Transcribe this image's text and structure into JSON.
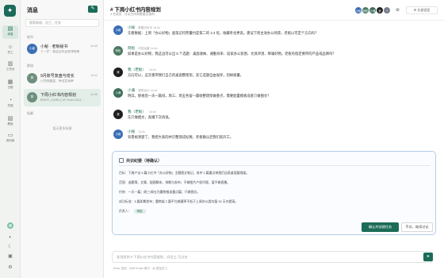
{
  "nav": {
    "items": [
      {
        "icon": "message-icon",
        "glyph": "▤",
        "label": "消息",
        "active": true
      },
      {
        "icon": "people-icon",
        "glyph": "☺",
        "label": "员工"
      },
      {
        "icon": "book-icon",
        "glyph": "▥",
        "label": "工作台"
      },
      {
        "icon": "calendar-icon",
        "glyph": "▦",
        "label": "日程"
      },
      {
        "icon": "bulb-icon",
        "glyph": "◔",
        "label": "灵感"
      },
      {
        "icon": "chart-icon",
        "glyph": "▨",
        "label": "看板"
      },
      {
        "icon": "folder-icon",
        "glyph": "▭",
        "label": "资料库"
      }
    ],
    "bottom": [
      "◐",
      "☾",
      "▣",
      "⚙"
    ]
  },
  "list": {
    "title": "消息",
    "new_button": "✎",
    "search_placeholder": "搜索联络、员工、任务",
    "sections": {
      "secretary": "秘书",
      "groups": "群组",
      "dm": "私聊"
    },
    "conversations": [
      {
        "avatar": "小秘",
        "avatar_color": "#3b6fb6",
        "name": "小秘 · 老板秘书",
        "time": "14:40",
        "preview": "下一步：我这边先去安排结果"
      },
      {
        "avatar": "群",
        "avatar_color": "#6e8f7c",
        "name": "9月账号复盘与增长",
        "time": "14:11",
        "preview": "已完成复盘：待议定清单"
      },
      {
        "avatar": "群",
        "avatar_color": "#6e8f7c",
        "name": "下周小红书内容规划",
        "time": "14:46",
        "preview": "BRIEF_CARD:{\"id\":\"brief-4241...",
        "selected": true
      }
    ],
    "empty_dm": "暂无更多私聊"
  },
  "chat": {
    "title": "# 下周小红书内容规划",
    "subtitle": "4 名成员 · 讨论方向和需要记录的",
    "members": [
      {
        "label": "小秘",
        "color": "#3b6fb6"
      },
      {
        "label": "阿松",
        "color": "#4b7a62"
      },
      {
        "label": "小满",
        "color": "#3d6f5a"
      },
      {
        "label": "我",
        "color": "#222222"
      },
      {
        "label": "+",
        "color": "#7a7f8c"
      }
    ],
    "add_member_icon": "⊕",
    "settings_label": "⚙ 头部设定",
    "messages": [
      {
        "avatar": "小秘",
        "color": "#3b6fb6",
        "author": "小秘",
        "time": "数据分析中 14:4x",
        "text": "先看数据：上周「办公好物」类笔记均赞量约是第二的 2.3 倍，收藏率也更高。建议下周主攻办公场景，老板以可定个方向吗？"
      },
      {
        "avatar": "阿松",
        "color": "#4b7a62",
        "author": "阿松",
        "time": "内容运营 14:4x",
        "text": "如果是办公好物，我这边可以出 5 个选题：桌面收纳、通勤效率、居家办公氛围、文具评测、降噪好物。老板有指定要带的产品或品牌吗？"
      },
      {
        "avatar": "我",
        "color": "#1f1f1f",
        "author": "我（老板）",
        "time": "14:4x",
        "text": "方向可以，这次重带我们自己的桌面整理架，其它选题自由发挥，别掉质量。"
      },
      {
        "avatar": "小满",
        "color": "#3d6f5a",
        "author": "小满",
        "time": "视觉设计 14:4x",
        "text": "明白。那视觉一天一篇排，周三、周五各留一篇收整理架做重点，需要配置模板成者只做图文？"
      },
      {
        "avatar": "我",
        "color": "#1f1f1f",
        "author": "我（老板）",
        "time": "14:4x",
        "text": "先只做图文，直播下次再说。"
      },
      {
        "avatar": "小秘",
        "color": "#3b6fb6",
        "author": "小秘",
        "time": "14:4x",
        "text": "背景帧清楚了，我把大家的共识整理成纪要，老板确认后我们就开工。"
      }
    ],
    "card": {
      "title": "共识纪要（待确认）",
      "rows": [
        {
          "k": "目标：",
          "v": "下周产出 5 篇小红书「办公好物」主题图文笔记，其中 2 篇重点带我们自家桌面整理架。"
        },
        {
          "k": "范围：",
          "v": "选题筛、文案、配图脚本、排期与发布；不做图片产权代理，暂不做直播。"
        },
        {
          "k": "约束：",
          "v": "一天一篇；周三/周五为重物推送重点篇；只做图文。"
        },
        {
          "k": "成功标准：",
          "v": "5 篇如期发布；重物架 2 篇平均收藏率不低于上周办公类均值 30 天内提高。"
        },
        {
          "k": "负责人：",
          "v": "",
          "tag": "阿松"
        }
      ],
      "confirm_label": "确认并创建任务",
      "discuss_label": "不对，继续讨论"
    },
    "composer": {
      "placeholder": "发消息到 # 下周小红书内容规划，@员工 可点名",
      "hint": "Enter 发送 · Shift+Enter 换行 · @ 提及员工",
      "send_icon": "➤"
    }
  }
}
